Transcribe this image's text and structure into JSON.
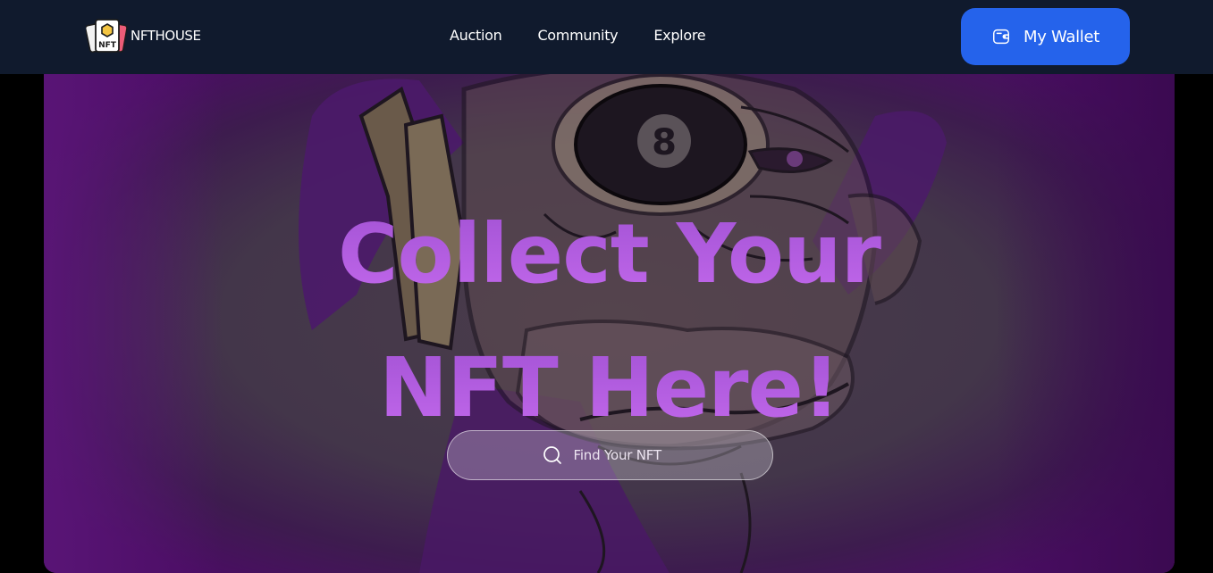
{
  "navbar": {
    "brand": {
      "logo_text": "NFT",
      "name": "NFTHOUSE"
    },
    "links": [
      {
        "label": "Auction"
      },
      {
        "label": "Community"
      },
      {
        "label": "Explore"
      }
    ],
    "wallet_button": {
      "label": "My Wallet",
      "icon": "wallet-icon"
    }
  },
  "hero": {
    "title_line1": "Collect Your",
    "title_line2": "NFT Here!",
    "search": {
      "placeholder": "Find Your NFT",
      "value": "",
      "icon": "search-icon"
    },
    "background_art": "ape-nft-illustration"
  },
  "colors": {
    "navbar_bg": "#101a2d",
    "accent_blue": "#2563eb",
    "title_purple_top": "#9d4fd0",
    "title_purple_bottom": "#c86cf0",
    "hero_purple": "#5a1a78",
    "page_bg": "#000000"
  }
}
